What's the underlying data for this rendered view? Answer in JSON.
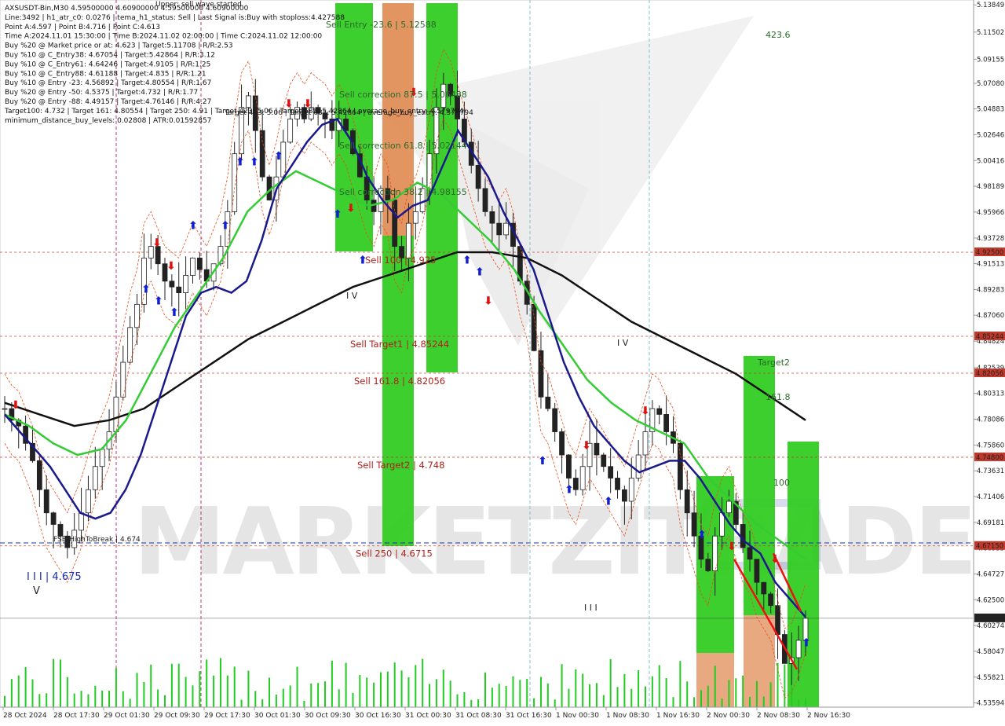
{
  "header": {
    "title_top": "Upper: sell wave started",
    "lines": [
      "AXSUSDT-Bin,M30  4.59500000 4.60900000 4.59500000 4.60900000",
      "Line:3492 | h1_atr_c0: 0.0276 | tema_h1_status: Sell | Last Signal is:Buy with stoploss:4.427588",
      "Point A:4.597 | Point B:4.716 | Point C:4.613",
      "Time A:2024.11.01 15:30:00 | Time B:2024.11.02 02:00:00 | Time C:2024.11.02 12:00:00",
      "Buy %20 @ Market price or at: 4.623 | Target:5.11708 | R/R:2.53",
      "Buy %10 @ C_Entry38: 4.67054 | Target:5.42864 | R/R:3.12",
      "Buy %10 @ C_Entry61: 4.64246 | Target:4.9105 | R/R:1.25",
      "Buy %10 @ C_Entry88: 4.61188 | Target:4.835 | R/R:1.21",
      "Buy %10 @ Entry -23: 4.56892 | Target:4.80554 | R/R:1.67",
      "Buy %20 @ Entry -50: 4.5375 | Target:4.732 | R/R:1.77",
      "Buy %20 @ Entry -88: 4.49157 | Target:4.76146 | R/R:4.27",
      "Target100: 4.732 | Target 161: 4.80554 | Target 250: 4.91 | Target 423: 5.06 | Target 685: 5.42864 | average_buy_entry: 4.579794",
      "minimum_distance_buy_levels: 0.02808 | ATR:0.01592857"
    ]
  },
  "watermark": "MARKETZITRADE",
  "chart_data": {
    "type": "candlestick",
    "symbol": "AXSUSDT-Bin",
    "timeframe": "M30",
    "ylim": [
      4.535,
      5.14
    ],
    "price_ticks": [
      "5.13849",
      "5.11502",
      "5.09155",
      "5.07080",
      "5.04883",
      "5.02646",
      "5.00416",
      "4.98189",
      "4.95966",
      "4.93728",
      "4.91513",
      "4.89283",
      "4.87060",
      "4.84824",
      "4.82539",
      "4.80313",
      "4.78086",
      "4.75860",
      "4.73631",
      "4.71406",
      "4.69181",
      "4.66955",
      "4.64727",
      "4.62500",
      "4.60274",
      "4.58047",
      "4.55821",
      "4.53594"
    ],
    "time_ticks": [
      "28 Oct 2024",
      "28 Oct 17:30",
      "29 Oct 01:30",
      "29 Oct 09:30",
      "29 Oct 17:30",
      "30 Oct 01:30",
      "30 Oct 09:30",
      "30 Oct 16:30",
      "31 Oct 00:30",
      "31 Oct 08:30",
      "31 Oct 16:30",
      "1 Nov 00:30",
      "1 Nov 08:30",
      "1 Nov 16:30",
      "2 Nov 00:30",
      "2 Nov 08:30",
      "2 Nov 16:30"
    ],
    "highlighted_prices": [
      {
        "value": "4.92500",
        "color": "#c0392b"
      },
      {
        "value": "4.85244",
        "color": "#c0392b"
      },
      {
        "value": "4.82056",
        "color": "#c0392b"
      },
      {
        "value": "4.74800",
        "color": "#c0392b"
      },
      {
        "value": "4.67150",
        "color": "#c0392b"
      },
      {
        "value": "4.60900",
        "color": "#222222"
      }
    ],
    "levels": [
      {
        "label": "Sell 100 | 4.925",
        "price": 4.925
      },
      {
        "label": "Sell Target1 | 4.85244",
        "price": 4.85244
      },
      {
        "label": "Sell 161.8 | 4.82056",
        "price": 4.82056
      },
      {
        "label": "Sell Target2 | 4.748",
        "price": 4.748
      },
      {
        "label": "Sell 250 | 4.6715",
        "price": 4.6715
      }
    ],
    "zone_labels": [
      "Sell Entry -23.6 | 5.12588",
      "Sell correction 87.5 | 5.06488",
      "Sell correction 61.8 | 5.02144",
      "Sell correction 38.2 | 4.98155",
      "423.6",
      "Target2",
      "161.8",
      "100"
    ],
    "annotations": [
      "I V",
      "I V",
      "I I I",
      "I I I | 4.675",
      "V",
      "FSB-HighToBreak | 4.674",
      "Target 423: 5.06 | Target 685: 5.42864 | average_buy_entry: 4.579794"
    ],
    "close_series": [
      4.79,
      4.78,
      4.775,
      4.76,
      4.745,
      4.72,
      4.7,
      4.69,
      4.68,
      4.67,
      4.685,
      4.7,
      4.72,
      4.74,
      4.755,
      4.77,
      4.8,
      4.83,
      4.86,
      4.88,
      4.92,
      4.93,
      4.915,
      4.9,
      4.895,
      4.89,
      4.905,
      4.92,
      4.91,
      4.9,
      4.915,
      4.93,
      4.96,
      5.01,
      5.05,
      5.06,
      5.03,
      4.99,
      4.97,
      4.99,
      5.02,
      5.04,
      5.05,
      5.04,
      5.05,
      5.045,
      5.04,
      5.03,
      5.04,
      5.03,
      5.01,
      4.99,
      4.97,
      4.96,
      4.98,
      4.97,
      4.93,
      4.92,
      4.95,
      4.96,
      4.98,
      5.01,
      5.05,
      5.07,
      5.06,
      5.04,
      5.02,
      5.0,
      4.98,
      4.96,
      4.95,
      4.94,
      4.95,
      4.93,
      4.9,
      4.88,
      4.84,
      4.8,
      4.79,
      4.77,
      4.75,
      4.73,
      4.72,
      4.74,
      4.76,
      4.75,
      4.74,
      4.73,
      4.72,
      4.71,
      4.73,
      4.75,
      4.77,
      4.79,
      4.785,
      4.77,
      4.76,
      4.72,
      4.7,
      4.68,
      4.66,
      4.65,
      4.68,
      4.7,
      4.71,
      4.69,
      4.67,
      4.66,
      4.64,
      4.63,
      4.62,
      4.595,
      4.57,
      4.575,
      4.59,
      4.609
    ],
    "ma_fast": [
      4.785,
      4.77,
      4.755,
      4.74,
      4.72,
      4.7,
      4.695,
      4.7,
      4.72,
      4.75,
      4.79,
      4.83,
      4.87,
      4.89,
      4.895,
      4.89,
      4.9,
      4.935,
      4.98,
      5.0,
      5.02,
      5.035,
      5.04,
      5.02,
      4.99,
      4.97,
      4.955,
      4.965,
      4.97,
      5.0,
      5.03,
      5.01,
      4.99,
      4.96,
      4.935,
      4.91,
      4.87,
      4.83,
      4.8,
      4.775,
      4.76,
      4.745,
      4.735,
      4.74,
      4.745,
      4.745,
      4.73,
      4.71,
      4.69,
      4.675,
      4.665,
      4.64,
      4.625,
      4.61
    ],
    "ma_mid": [
      4.785,
      4.775,
      4.76,
      4.75,
      4.755,
      4.78,
      4.82,
      4.86,
      4.89,
      4.92,
      4.96,
      4.98,
      4.995,
      4.985,
      4.975,
      4.965,
      4.97,
      4.985,
      4.975,
      4.955,
      4.935,
      4.91,
      4.875,
      4.845,
      4.815,
      4.795,
      4.78,
      4.77,
      4.76,
      4.73,
      4.71,
      4.69,
      4.675,
      4.66
    ],
    "ma_slow": [
      4.795,
      4.785,
      4.775,
      4.78,
      4.79,
      4.81,
      4.83,
      4.85,
      4.865,
      4.88,
      4.895,
      4.905,
      4.915,
      4.925,
      4.925,
      4.92,
      4.905,
      4.885,
      4.865,
      4.85,
      4.835,
      4.82,
      4.8,
      4.78
    ]
  }
}
